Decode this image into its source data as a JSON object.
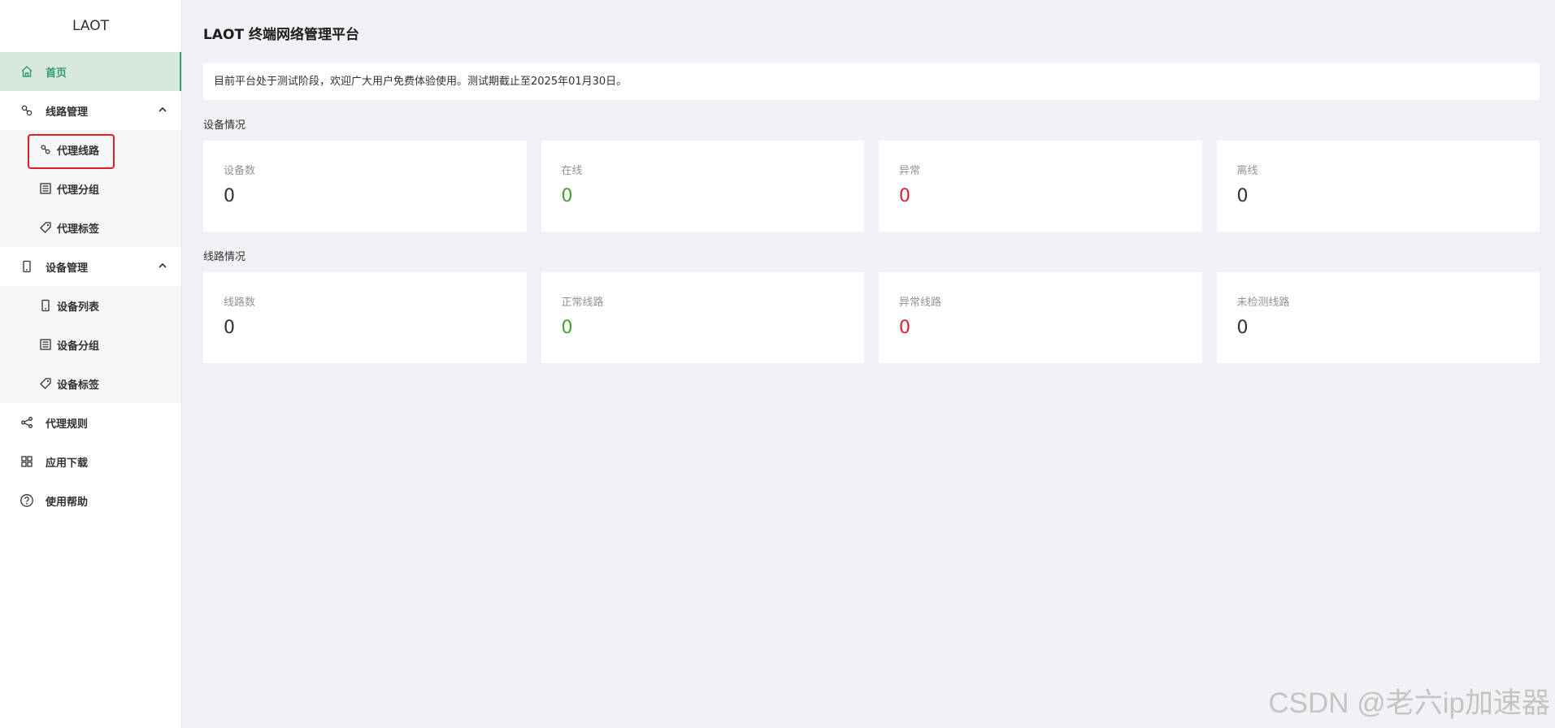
{
  "app": {
    "logo": "LAOT"
  },
  "sidebar": {
    "home": {
      "label": "首页",
      "icon": "home-icon"
    },
    "line_mgmt": {
      "label": "线路管理",
      "icon": "link-icon",
      "items": [
        {
          "label": "代理线路",
          "icon": "link-icon"
        },
        {
          "label": "代理分组",
          "icon": "group-icon"
        },
        {
          "label": "代理标签",
          "icon": "tag-icon"
        }
      ]
    },
    "device_mgmt": {
      "label": "设备管理",
      "icon": "phone-icon",
      "items": [
        {
          "label": "设备列表",
          "icon": "phone-icon"
        },
        {
          "label": "设备分组",
          "icon": "group-icon"
        },
        {
          "label": "设备标签",
          "icon": "tag-icon"
        }
      ]
    },
    "proxy_rules": {
      "label": "代理规则",
      "icon": "share-icon"
    },
    "app_download": {
      "label": "应用下载",
      "icon": "grid-icon"
    },
    "help": {
      "label": "使用帮助",
      "icon": "help-icon"
    }
  },
  "main": {
    "title": "LAOT 终端网络管理平台",
    "notice": "目前平台处于测试阶段，欢迎广大用户免费体验使用。测试期截止至2025年01月30日。",
    "device_section": {
      "title": "设备情况",
      "cards": [
        {
          "label": "设备数",
          "value": "0"
        },
        {
          "label": "在线",
          "value": "0"
        },
        {
          "label": "异常",
          "value": "0"
        },
        {
          "label": "离线",
          "value": "0"
        }
      ]
    },
    "line_section": {
      "title": "线路情况",
      "cards": [
        {
          "label": "线路数",
          "value": "0"
        },
        {
          "label": "正常线路",
          "value": "0"
        },
        {
          "label": "异常线路",
          "value": "0"
        },
        {
          "label": "未检测线路",
          "value": "0"
        }
      ]
    }
  },
  "colors": {
    "accent": "#2f9e6a",
    "active_bg": "#d7e8de",
    "green_value": "#43a02c",
    "red_value": "#d9212c",
    "highlight_box": "#e02020"
  },
  "watermark": "CSDN @老六ip加速器"
}
